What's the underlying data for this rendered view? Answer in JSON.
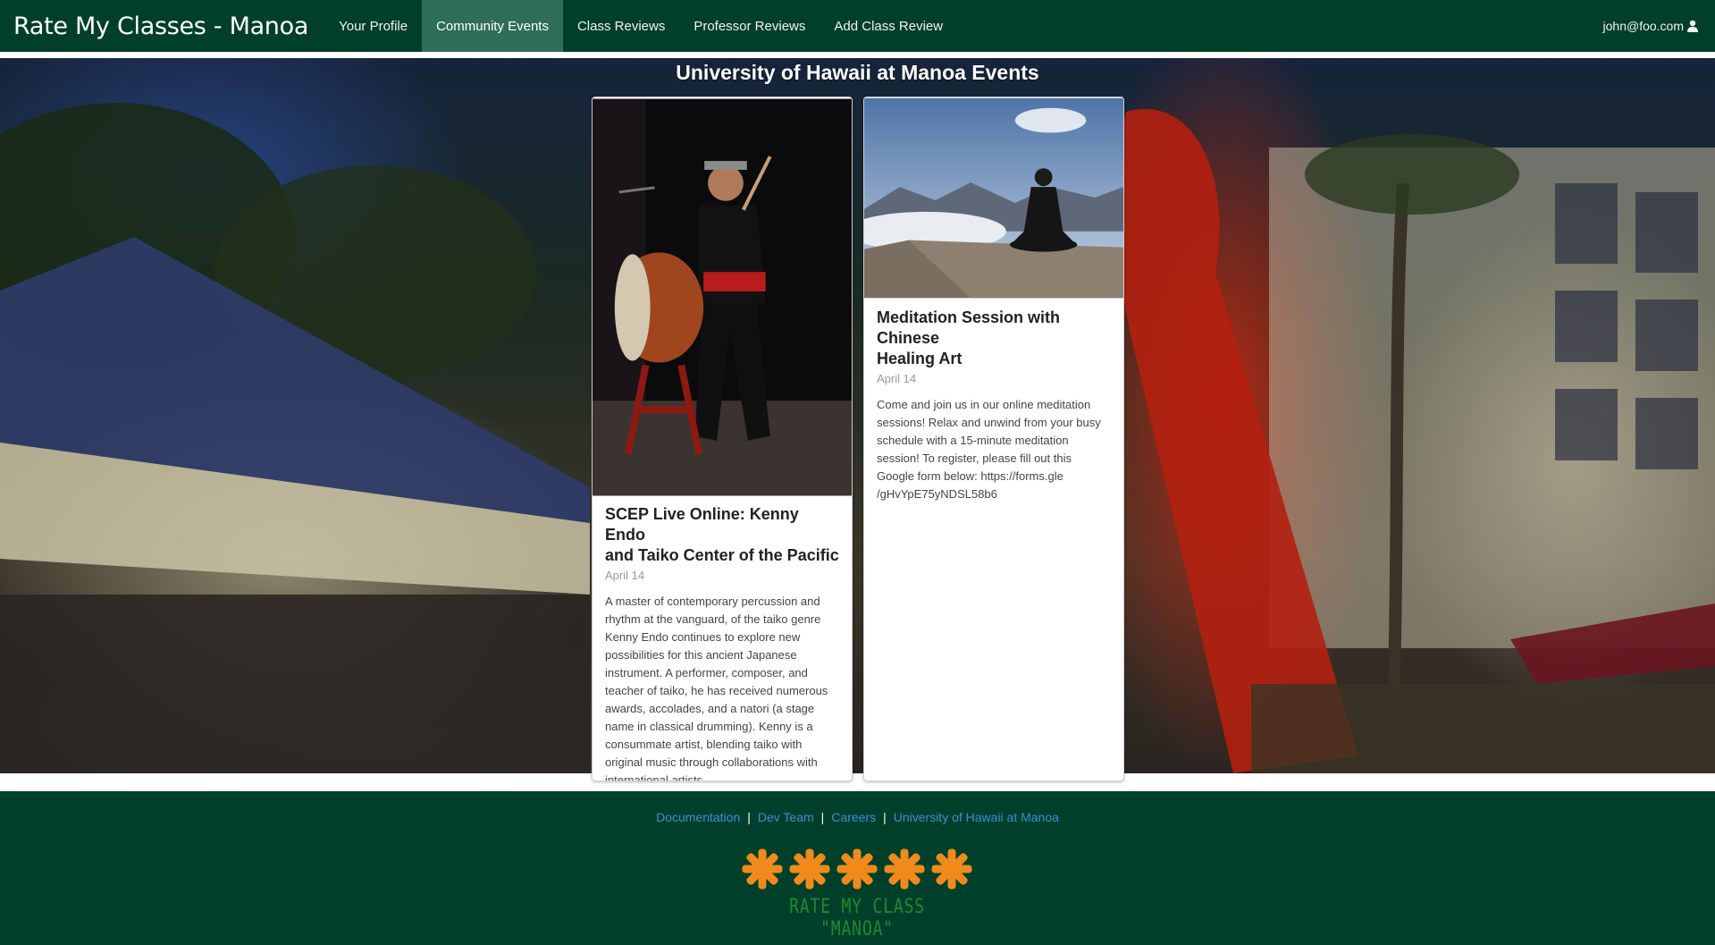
{
  "navbar": {
    "brand": "Rate My Classes - Manoa",
    "items": [
      {
        "label": "Your Profile",
        "active": false
      },
      {
        "label": "Community Events",
        "active": true
      },
      {
        "label": "Class Reviews",
        "active": false
      },
      {
        "label": "Professor Reviews",
        "active": false
      },
      {
        "label": "Add Class Review",
        "active": false
      }
    ],
    "user": "john@foo.com"
  },
  "hero": {
    "title": "University of Hawaii at Manoa Events"
  },
  "events": [
    {
      "title_line1": "SCEP Live Online: Kenny Endo",
      "title_line2": "and Taiko Center of the Pacific",
      "date": "April 14",
      "description": "A master of contemporary percussion and rhythm at the vanguard, of the taiko genre Kenny Endo continues to explore new possibilities for this ancient Japanese instrument. A performer, composer, and teacher of taiko, he has received numerous awards, accolades, and a natori (a stage name in classical drumming). Kenny is a consummate artist, blending taiko with original music through collaborations with international artists."
    },
    {
      "title_line1": "Meditation Session with Chinese",
      "title_line2": "Healing Art",
      "date": "April 14",
      "description": "Come and join us in our online meditation sessions! Relax and unwind from your busy schedule with a 15-minute meditation session! To register, please fill out this Google form below: https://forms.gle /gHvYpE75yNDSL58b6"
    }
  ],
  "footer": {
    "links": [
      "Documentation",
      "Dev Team",
      "Careers",
      "University of Hawaii at Manoa"
    ],
    "logo_text": "RATE MY CLASS \"MANOA\""
  },
  "colors": {
    "navbar_bg": "#003f2a",
    "nav_active_bg": "#2e6e58",
    "footer_bg": "#003f2a",
    "link": "#3a8fd6",
    "logo_star": "#f08a1c",
    "logo_text": "#1e8a2e"
  },
  "icons": {
    "user": "user-icon",
    "logo": "asterisk-stars-logo"
  }
}
